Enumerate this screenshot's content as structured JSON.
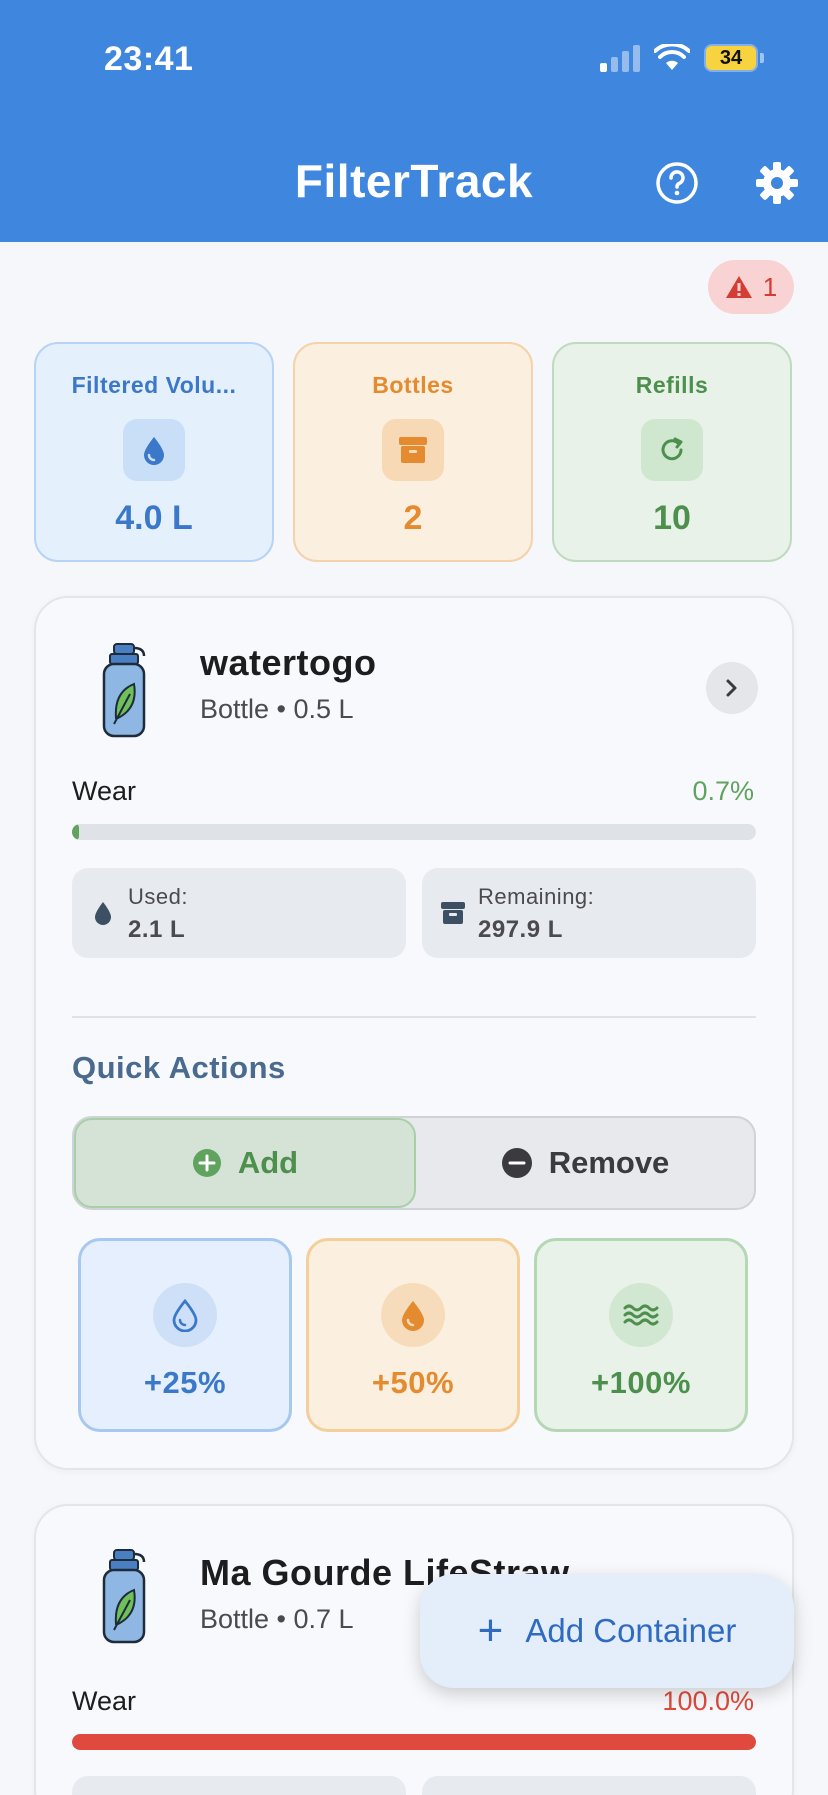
{
  "status": {
    "time": "23:41",
    "battery": "34"
  },
  "header": {
    "title": "FilterTrack"
  },
  "alert": {
    "count": "1"
  },
  "stats": [
    {
      "label": "Filtered Volu...",
      "value": "4.0 L"
    },
    {
      "label": "Bottles",
      "value": "2"
    },
    {
      "label": "Refills",
      "value": "10"
    }
  ],
  "containers": [
    {
      "name": "watertogo",
      "subtitle": "Bottle • 0.5 L",
      "wear_label": "Wear",
      "wear_value": "0.7%",
      "wear_fraction": 0.007,
      "used_label": "Used:",
      "used_value": "2.1 L",
      "remaining_label": "Remaining:",
      "remaining_value": "297.9 L"
    },
    {
      "name": "Ma Gourde LifeStraw",
      "subtitle": "Bottle • 0.7 L",
      "wear_label": "Wear",
      "wear_value": "100.0%",
      "wear_fraction": 1.0
    }
  ],
  "quick_actions": {
    "title": "Quick Actions",
    "add_label": "Add",
    "remove_label": "Remove",
    "buttons": [
      "+25%",
      "+50%",
      "+100%"
    ]
  },
  "fab": {
    "label": "Add Container"
  },
  "colors": {
    "primary": "#3f86de",
    "green": "#4d8f4d",
    "orange": "#e48a2f",
    "danger": "#e0493d"
  }
}
